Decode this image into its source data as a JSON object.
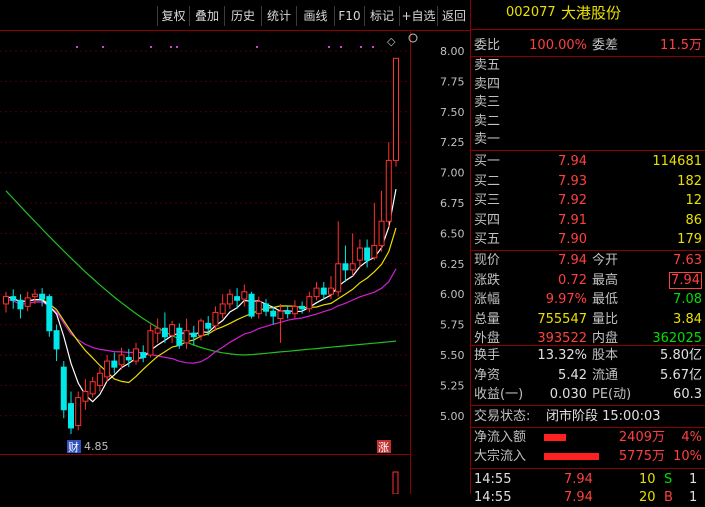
{
  "toolbar": {
    "buttons": [
      "复权",
      "叠加",
      "历史",
      "统计",
      "画线",
      "F10",
      "标记",
      "+自选",
      "返回"
    ]
  },
  "chart": {
    "price_ticks": [
      "8.00",
      "7.75",
      "7.50",
      "7.25",
      "7.00",
      "6.75",
      "6.50",
      "6.25",
      "6.00",
      "5.75",
      "5.50",
      "5.25",
      "5.00"
    ],
    "low_marker": "4.85",
    "badge_cai": "财",
    "badge_zhang": "涨",
    "diamond": "◇",
    "candles": [
      {
        "o": 5.92,
        "c": 5.98,
        "h": 6.02,
        "l": 5.85
      },
      {
        "o": 5.98,
        "c": 5.95,
        "h": 6.04,
        "l": 5.88
      },
      {
        "o": 5.95,
        "c": 5.88,
        "h": 6.0,
        "l": 5.8
      },
      {
        "o": 5.9,
        "c": 5.97,
        "h": 6.02,
        "l": 5.86
      },
      {
        "o": 5.98,
        "c": 6.0,
        "h": 6.04,
        "l": 5.92
      },
      {
        "o": 6.0,
        "c": 5.96,
        "h": 6.05,
        "l": 5.9
      },
      {
        "o": 5.98,
        "c": 5.7,
        "h": 6.0,
        "l": 5.65
      },
      {
        "o": 5.7,
        "c": 5.55,
        "h": 5.75,
        "l": 5.45
      },
      {
        "o": 5.4,
        "c": 5.05,
        "h": 5.45,
        "l": 4.98
      },
      {
        "o": 5.1,
        "c": 4.9,
        "h": 5.2,
        "l": 4.85
      },
      {
        "o": 4.92,
        "c": 5.15,
        "h": 5.2,
        "l": 4.88
      },
      {
        "o": 5.12,
        "c": 5.2,
        "h": 5.3,
        "l": 5.05
      },
      {
        "o": 5.18,
        "c": 5.28,
        "h": 5.32,
        "l": 5.15
      },
      {
        "o": 5.25,
        "c": 5.35,
        "h": 5.4,
        "l": 5.2
      },
      {
        "o": 5.32,
        "c": 5.45,
        "h": 5.5,
        "l": 5.28
      },
      {
        "o": 5.45,
        "c": 5.4,
        "h": 5.52,
        "l": 5.35
      },
      {
        "o": 5.42,
        "c": 5.5,
        "h": 5.56,
        "l": 5.38
      },
      {
        "o": 5.48,
        "c": 5.46,
        "h": 5.55,
        "l": 5.4
      },
      {
        "o": 5.45,
        "c": 5.55,
        "h": 5.6,
        "l": 5.42
      },
      {
        "o": 5.52,
        "c": 5.48,
        "h": 5.58,
        "l": 5.44
      },
      {
        "o": 5.5,
        "c": 5.7,
        "h": 5.75,
        "l": 5.48
      },
      {
        "o": 5.68,
        "c": 5.72,
        "h": 5.8,
        "l": 5.6
      },
      {
        "o": 5.72,
        "c": 5.65,
        "h": 5.85,
        "l": 5.6
      },
      {
        "o": 5.66,
        "c": 5.75,
        "h": 5.78,
        "l": 5.6
      },
      {
        "o": 5.72,
        "c": 5.58,
        "h": 5.76,
        "l": 5.55
      },
      {
        "o": 5.6,
        "c": 5.7,
        "h": 5.8,
        "l": 5.55
      },
      {
        "o": 5.68,
        "c": 5.65,
        "h": 5.74,
        "l": 5.58
      },
      {
        "o": 5.66,
        "c": 5.78,
        "h": 5.8,
        "l": 5.62
      },
      {
        "o": 5.76,
        "c": 5.72,
        "h": 5.82,
        "l": 5.66
      },
      {
        "o": 5.74,
        "c": 5.85,
        "h": 5.9,
        "l": 5.7
      },
      {
        "o": 5.84,
        "c": 5.92,
        "h": 6.0,
        "l": 5.8
      },
      {
        "o": 5.92,
        "c": 6.0,
        "h": 6.04,
        "l": 5.88
      },
      {
        "o": 5.98,
        "c": 5.95,
        "h": 6.05,
        "l": 5.88
      },
      {
        "o": 5.96,
        "c": 6.02,
        "h": 6.08,
        "l": 5.9
      },
      {
        "o": 6.0,
        "c": 5.82,
        "h": 6.02,
        "l": 5.8
      },
      {
        "o": 5.84,
        "c": 5.94,
        "h": 5.98,
        "l": 5.8
      },
      {
        "o": 5.92,
        "c": 5.86,
        "h": 5.96,
        "l": 5.82
      },
      {
        "o": 5.86,
        "c": 5.82,
        "h": 5.9,
        "l": 5.75
      },
      {
        "o": 5.8,
        "c": 5.86,
        "h": 5.92,
        "l": 5.6
      },
      {
        "o": 5.86,
        "c": 5.84,
        "h": 5.9,
        "l": 5.8
      },
      {
        "o": 5.84,
        "c": 5.9,
        "h": 5.95,
        "l": 5.8
      },
      {
        "o": 5.9,
        "c": 5.88,
        "h": 5.94,
        "l": 5.84
      },
      {
        "o": 5.88,
        "c": 5.98,
        "h": 6.02,
        "l": 5.85
      },
      {
        "o": 5.98,
        "c": 6.05,
        "h": 6.1,
        "l": 5.95
      },
      {
        "o": 6.05,
        "c": 6.0,
        "h": 6.1,
        "l": 5.96
      },
      {
        "o": 6.0,
        "c": 6.05,
        "h": 6.15,
        "l": 5.96
      },
      {
        "o": 6.02,
        "c": 6.25,
        "h": 6.6,
        "l": 5.98
      },
      {
        "o": 6.25,
        "c": 6.2,
        "h": 6.4,
        "l": 6.1
      },
      {
        "o": 6.2,
        "c": 6.25,
        "h": 6.5,
        "l": 6.15
      },
      {
        "o": 6.28,
        "c": 6.38,
        "h": 6.45,
        "l": 6.22
      },
      {
        "o": 6.38,
        "c": 6.28,
        "h": 6.45,
        "l": 6.22
      },
      {
        "o": 6.3,
        "c": 6.4,
        "h": 6.75,
        "l": 6.28
      },
      {
        "o": 6.4,
        "c": 6.6,
        "h": 6.85,
        "l": 6.35
      },
      {
        "o": 6.6,
        "c": 7.1,
        "h": 7.25,
        "l": 6.55
      },
      {
        "o": 7.1,
        "c": 7.94,
        "h": 7.94,
        "l": 7.05
      }
    ]
  },
  "panel": {
    "code": "002077",
    "name": "大港股份",
    "weibi_label": "委比",
    "weibi_value": "100.00%",
    "weicha_label": "委差",
    "weicha_value": "11.5万",
    "sell_labels": [
      "卖五",
      "卖四",
      "卖三",
      "卖二",
      "卖一"
    ],
    "buy": [
      {
        "label": "买一",
        "price": "7.94",
        "vol": "114681"
      },
      {
        "label": "买二",
        "price": "7.93",
        "vol": "182"
      },
      {
        "label": "买三",
        "price": "7.92",
        "vol": "12"
      },
      {
        "label": "买四",
        "price": "7.91",
        "vol": "86"
      },
      {
        "label": "买五",
        "price": "7.90",
        "vol": "179"
      }
    ],
    "stats": [
      {
        "l1": "现价",
        "v1": "7.94",
        "l2": "今开",
        "v2": "7.63"
      },
      {
        "l1": "涨跌",
        "v1": "0.72",
        "l2": "最高",
        "v2": "7.94"
      },
      {
        "l1": "涨幅",
        "v1": "9.97%",
        "l2": "最低",
        "v2": "7.08"
      },
      {
        "l1": "总量",
        "v1": "755547",
        "l2": "量比",
        "v2": "3.84"
      },
      {
        "l1": "外盘",
        "v1": "393522",
        "l2": "内盘",
        "v2": "362025"
      }
    ],
    "stats2": [
      {
        "l1": "换手",
        "v1": "13.32%",
        "l2": "股本",
        "v2": "5.80亿"
      },
      {
        "l1": "净资",
        "v1": "5.42",
        "l2": "流通",
        "v2": "5.67亿"
      },
      {
        "l1": "收益(一)",
        "v1": "0.030",
        "l2": "PE(动)",
        "v2": "60.3"
      }
    ],
    "status_label": "交易状态:",
    "status_value": "闭市阶段 15:00:03",
    "flow": [
      {
        "label": "净流入额",
        "amount": "2409万",
        "pct": "4%",
        "ratio": 0.4
      },
      {
        "label": "大宗流入",
        "amount": "5775万",
        "pct": "10%",
        "ratio": 1.0
      }
    ],
    "ticks": [
      {
        "time": "14:55",
        "price": "7.94",
        "vol": "10",
        "flag": "S",
        "n": "1"
      },
      {
        "time": "14:55",
        "price": "7.94",
        "vol": "20",
        "flag": "B",
        "n": "1"
      }
    ]
  }
}
